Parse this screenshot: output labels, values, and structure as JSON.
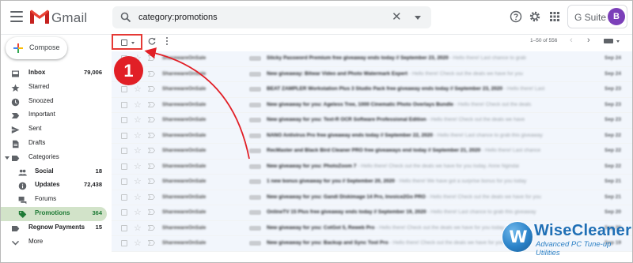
{
  "header": {
    "app_name": "Gmail",
    "search_value": "category:promotions",
    "search_clear": "✕",
    "gsuite_label": "G Suite",
    "avatar_letter": "B"
  },
  "compose": {
    "label": "Compose"
  },
  "sidebar": {
    "items": [
      {
        "label": "Inbox",
        "count": "79,006",
        "icon": "inbox-icon",
        "bold": true
      },
      {
        "label": "Starred",
        "count": "",
        "icon": "star-icon"
      },
      {
        "label": "Snoozed",
        "count": "",
        "icon": "clock-icon"
      },
      {
        "label": "Important",
        "count": "",
        "icon": "important-icon"
      },
      {
        "label": "Sent",
        "count": "",
        "icon": "send-icon"
      },
      {
        "label": "Drafts",
        "count": "",
        "icon": "draft-icon"
      },
      {
        "label": "Categories",
        "count": "",
        "icon": "label-icon"
      },
      {
        "label": "Social",
        "count": "18",
        "icon": "people-icon",
        "bold": true
      },
      {
        "label": "Updates",
        "count": "72,438",
        "icon": "info-icon",
        "bold": true
      },
      {
        "label": "Forums",
        "count": "",
        "icon": "forum-icon"
      },
      {
        "label": "Promotions",
        "count": "364",
        "icon": "tag-icon",
        "bold": true,
        "active": true
      },
      {
        "label": "Regnow Payments",
        "count": "15",
        "icon": "label-icon",
        "bold": true
      },
      {
        "label": "More",
        "count": "",
        "icon": "chevron-down-icon"
      }
    ]
  },
  "toolbar": {
    "range": "1–50 of 556",
    "prev": "‹",
    "next": "›"
  },
  "callout": {
    "number": "1"
  },
  "emails": [
    {
      "sender": "SharewareOnSale",
      "subject": "Sticky Password Premium free giveaway ends today // September 23, 2020",
      "snippet": " - Hello there! Last chance to grab",
      "date": "Sep 24"
    },
    {
      "sender": "SharewareOnSale",
      "subject": "New giveaway: Bitwar Video and Photo Watermark Expert",
      "snippet": " - Hello there! Check out the deals we have for you",
      "date": "Sep 24"
    },
    {
      "sender": "SharewareOnSale",
      "subject": "BEAT ZAMPLER Workstation Plus 3 Studio Pack free giveaway ends today // September 23, 2020",
      "snippet": " - Hello there! Last",
      "date": "Sep 23"
    },
    {
      "sender": "SharewareOnSale",
      "subject": "New giveaway for you: Ageless Tree, 1000 Cinematic Photo Overlays Bundle",
      "snippet": " - Hello there! Check out the deals",
      "date": "Sep 23"
    },
    {
      "sender": "SharewareOnSale",
      "subject": "New giveaway for you: Text-R OCR Software Professional Edition",
      "snippet": " - Hello there! Check out the deals we have",
      "date": "Sep 23"
    },
    {
      "sender": "SharewareOnSale",
      "subject": "NANO Antivirus Pro free giveaway ends today // September 22, 2020",
      "snippet": " - Hello there! Last chance to grab this giveaway",
      "date": "Sep 22"
    },
    {
      "sender": "SharewareOnSale",
      "subject": "RecMaster and Black Bird Cleaner PRO free giveaways end today // September 21, 2020",
      "snippet": " - Hello there! Last chance",
      "date": "Sep 22"
    },
    {
      "sender": "SharewareOnSale",
      "subject": "New giveaway for you: PhotoZoom 7",
      "snippet": " - Hello there! Check out the deals we have for you today. Anne Ngindai",
      "date": "Sep 22"
    },
    {
      "sender": "SharewareOnSale",
      "subject": "1 new bonus giveaway for you // September 20, 2020",
      "snippet": " - Hello there! We have got a surprise bonus for you today",
      "date": "Sep 21"
    },
    {
      "sender": "SharewareOnSale",
      "subject": "New giveaway for you: Gandi Diskimage 14 Pro, Invoice2Go PRO",
      "snippet": " - Hello there! Check out the deals we have for you",
      "date": "Sep 21"
    },
    {
      "sender": "SharewareOnSale",
      "subject": "OnlineTV 15 Plus free giveaway ends today // September 19, 2020",
      "snippet": " - Hello there! Last chance to grab this giveaway",
      "date": "Sep 20"
    },
    {
      "sender": "SharewareOnSale",
      "subject": "New giveaway for you: CotGot 5, Reweb Pro",
      "snippet": " - Hello there! Check out the deals we have for you today",
      "date": "Sep 20"
    },
    {
      "sender": "SharewareOnSale",
      "subject": "New giveaway for you: Backup and Sync Tool Pro",
      "snippet": " - Hello there! Check out the deals we have for you today",
      "date": "Sep 19"
    }
  ],
  "watermark": {
    "logo_letter": "W",
    "name": "WiseCleaner",
    "tagline": "Advanced PC Tune-up Utilities"
  },
  "colors": {
    "callout_red": "#e11f26",
    "promotions_bg": "#d2e3c9",
    "promotions_text": "#1e7a35",
    "avatar": "#7b3fb9",
    "brand_blue": "#1f6fb5"
  }
}
